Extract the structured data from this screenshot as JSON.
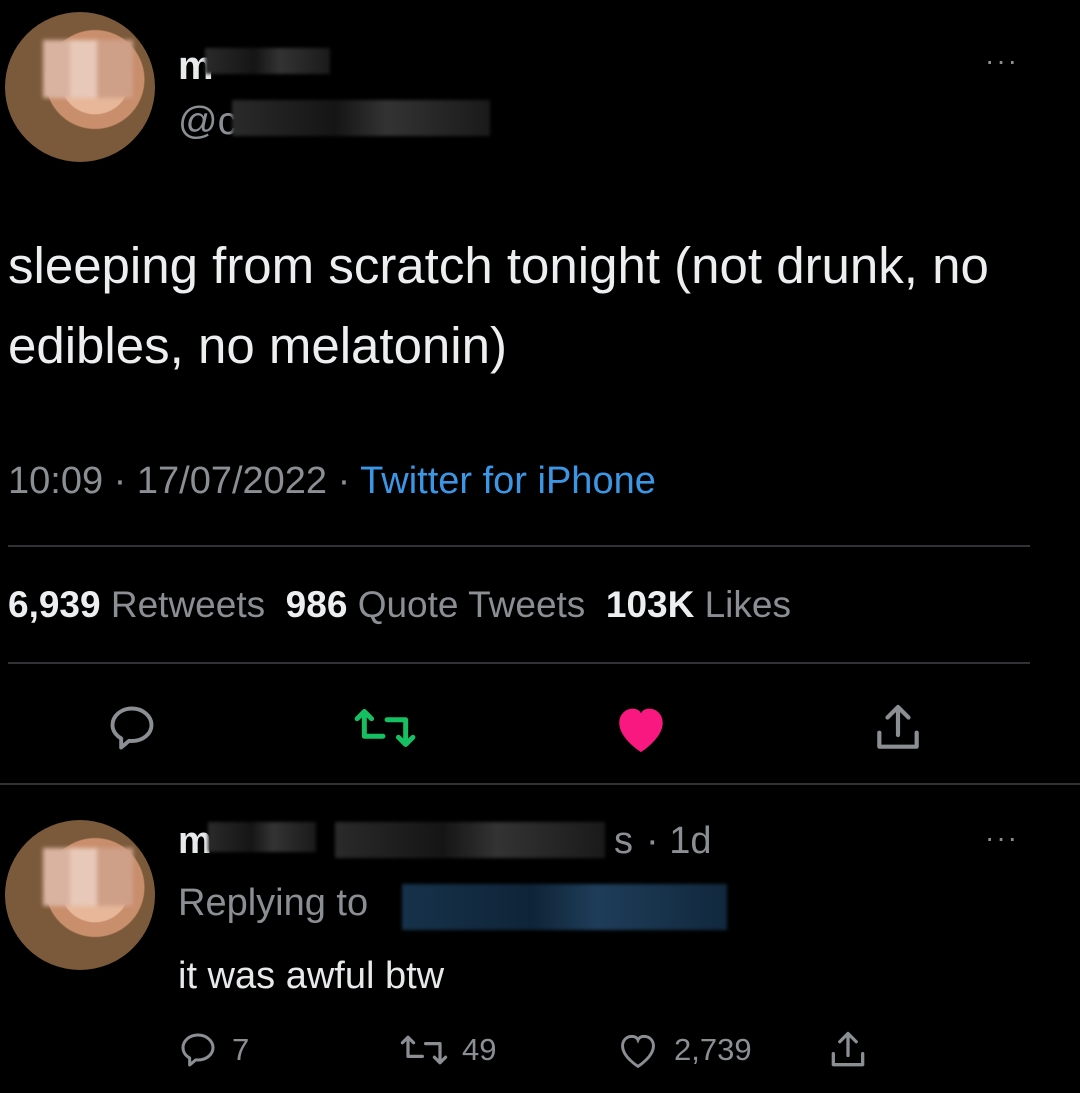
{
  "main_tweet": {
    "name": "m",
    "handle": "@c",
    "more": "···",
    "text": "sleeping from scratch tonight (not drunk, no edibles, no melatonin)",
    "time": "10:09",
    "sep1": "·",
    "date": "17/07/2022",
    "sep2": "·",
    "source": "Twitter for iPhone",
    "retweets_count": "6,939",
    "retweets_label": "Retweets",
    "quotes_count": "986",
    "quotes_label": "Quote Tweets",
    "likes_count": "103K",
    "likes_label": "Likes",
    "colors": {
      "retweet": "#17bf63",
      "like": "#f91880",
      "link": "#3b97e6"
    }
  },
  "reply": {
    "name": "m",
    "handle_fragment": "s",
    "time": "· 1d",
    "replying_label": "Replying to",
    "text": "it was awful btw",
    "more": "···",
    "reply_count": "7",
    "retweet_count": "49",
    "like_count": "2,739"
  },
  "icons": [
    "reply-icon",
    "retweet-icon",
    "like-icon",
    "share-icon"
  ]
}
